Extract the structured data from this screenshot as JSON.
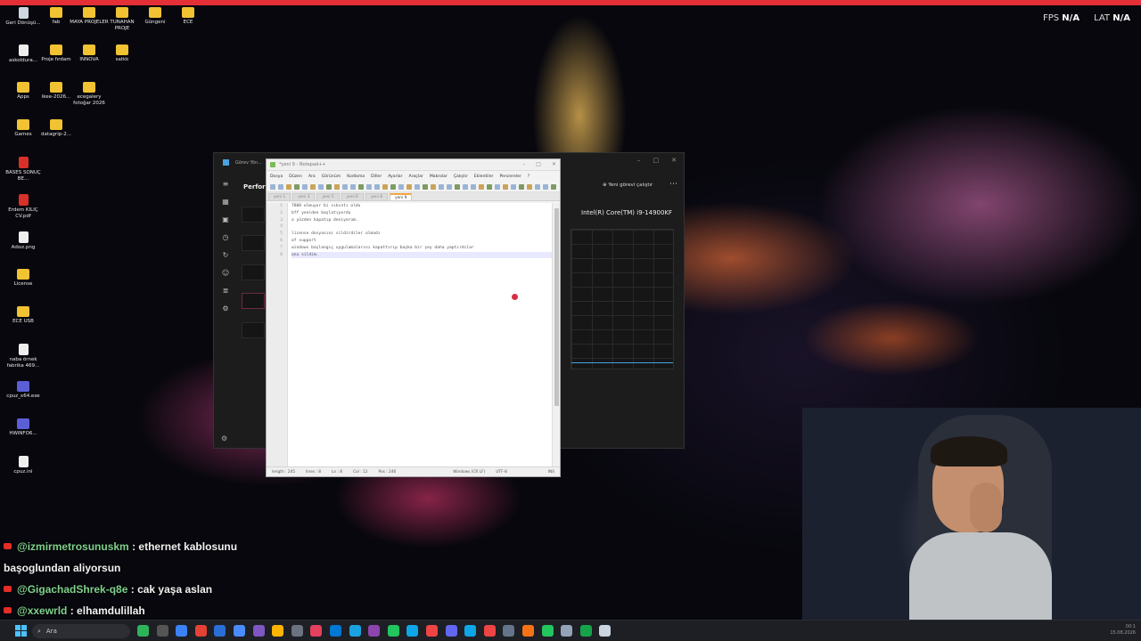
{
  "overlay": {
    "fps_label": "FPS",
    "fps_value": "N/A",
    "lat_label": "LAT",
    "lat_value": "N/A"
  },
  "desktop": {
    "icons": [
      {
        "label": "Geri Dönüşü...",
        "kind": "bin"
      },
      {
        "label": "fab",
        "kind": "folder"
      },
      {
        "label": "MAYA PROJELER",
        "kind": "folder"
      },
      {
        "label": "TUNAHAN PROJE",
        "kind": "folder"
      },
      {
        "label": "Güngeni",
        "kind": "folder"
      },
      {
        "label": "ECE",
        "kind": "folder"
      },
      {
        "label": "askoldura...",
        "kind": "file"
      },
      {
        "label": "Proje fırdam",
        "kind": "folder"
      },
      {
        "label": "INNOVA",
        "kind": "folder"
      },
      {
        "label": "satkk",
        "kind": "folder"
      },
      {
        "label": "Apps",
        "kind": "folder"
      },
      {
        "label": "ikee-2026...",
        "kind": "folder"
      },
      {
        "label": "ecegalery fotoğar 2026",
        "kind": "folder"
      },
      {
        "label": "Games",
        "kind": "folder"
      },
      {
        "label": "datagrip-2...",
        "kind": "folder"
      },
      {
        "label": "BASES SONUÇ BE...",
        "kind": "pdf"
      },
      {
        "label": "Erdem KILIÇ CV.pdf",
        "kind": "pdf"
      },
      {
        "label": "Adsız.png",
        "kind": "file"
      },
      {
        "label": "License",
        "kind": "folder"
      },
      {
        "label": "ECE USB",
        "kind": "folder"
      },
      {
        "label": "naba örnek fabrika 469...",
        "kind": "file"
      },
      {
        "label": "cpuz_x64.exe",
        "kind": "app"
      },
      {
        "label": "HWiNFO6...",
        "kind": "app"
      },
      {
        "label": "cpuz.ini",
        "kind": "file"
      }
    ]
  },
  "taskmanager": {
    "title": "Görev Yön...",
    "section": "Perform",
    "run_task": "Yeni görevi çalıştır",
    "cpu_name": "Intel(R) Core(TM) i9-14900KF"
  },
  "notepad": {
    "title": "*yeni 9 - Notepad++",
    "menu": [
      "Dosya",
      "Düzen",
      "Ara",
      "Görünüm",
      "Kodlama",
      "Diller",
      "Ayarlar",
      "Araçlar",
      "Makrolar",
      "Çalıştır",
      "Eklentiler",
      "Pencereler",
      "?"
    ],
    "tabs": [
      "yeni 1",
      "yeni 3",
      "yeni 5",
      "yeni 6",
      "yeni 8",
      "yeni 9"
    ],
    "lines": [
      "7800 olmuyor bi sıkıntı oldu",
      "bff yeniden başlatıyordu",
      "o yüzden kapatıp deniyorum.",
      "",
      "license dosyasını sildirdiler olmadı",
      "of support",
      "windows başlangıç uygulamalarını kapattırıp başka bir şey daha yaptırdılar",
      "onu sildim."
    ],
    "line_numbers": [
      "1",
      "2",
      "3",
      "4",
      "5",
      "6",
      "7",
      "8"
    ],
    "status": {
      "length": "length : 245",
      "lines": "lines : 8",
      "ln": "Ln : 8",
      "col": "Col : 12",
      "pos": "Pos : 246",
      "eol": "Windows (CR LF)",
      "encoding": "UTF-8",
      "mode": "INS"
    }
  },
  "chat": [
    {
      "user": "@izmirmetrosunuskm",
      "text": " : ethernet kablosunu başoglundan aliyorsun"
    },
    {
      "user": "@GigachadShrek-q8e",
      "text": " : cak yaşa aslan"
    },
    {
      "user": "@xxewrld",
      "text": " : elhamdulillah"
    }
  ],
  "taskbar": {
    "search_placeholder": "Ara",
    "clock_time": "00:1",
    "clock_date": "15.08.2026"
  }
}
